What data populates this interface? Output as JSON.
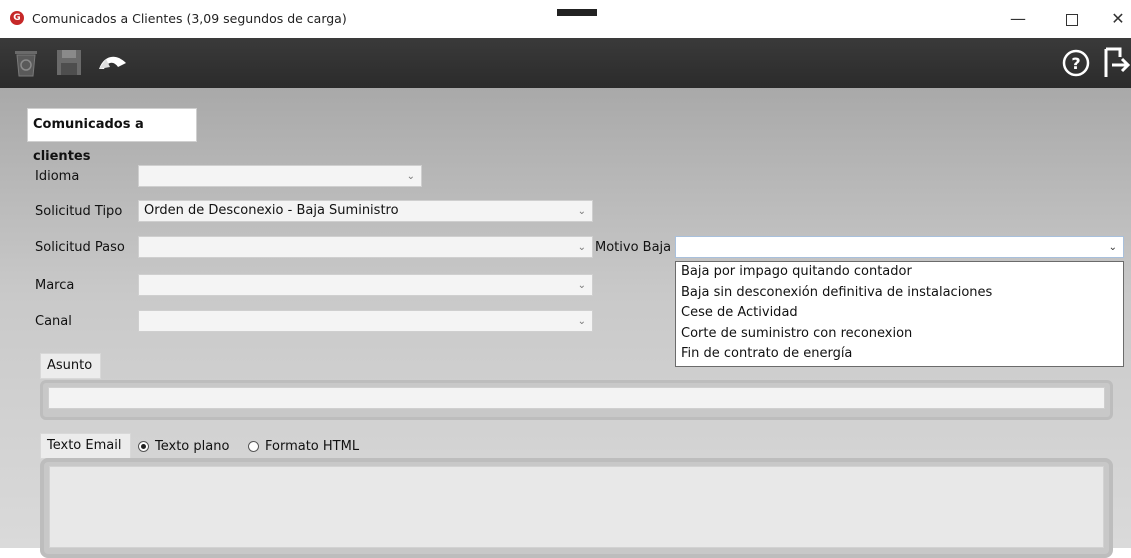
{
  "window": {
    "title": "Comunicados a Clientes (3,09 segundos de carga)",
    "minimize": "—",
    "close": "✕"
  },
  "toolbar": {
    "icons": [
      "trash-icon",
      "save-icon",
      "undo-icon",
      "help-icon",
      "exit-icon"
    ]
  },
  "form": {
    "section_title": "Comunicados a clientes",
    "idioma": {
      "label": "Idioma",
      "value": ""
    },
    "solicitud_tipo": {
      "label": "Solicitud Tipo",
      "value": "Orden de Desconexio - Baja Suministro"
    },
    "solicitud_paso": {
      "label": "Solicitud Paso",
      "value": ""
    },
    "motivo_baja": {
      "label": "Motivo Baja",
      "value": "",
      "options": [
        "Baja por impago quitando contador",
        "Baja sin desconexión definitiva de instalaciones",
        "Cese de Actividad",
        "Corte de suministro con reconexion",
        "Fin de contrato de energía"
      ]
    },
    "marca": {
      "label": "Marca",
      "value": ""
    },
    "canal": {
      "label": "Canal",
      "value": ""
    },
    "asunto": {
      "label": "Asunto",
      "value": ""
    },
    "texto_email": {
      "label": "Texto Email",
      "radio_plain": "Texto plano",
      "radio_html": "Formato HTML",
      "selected": "Texto plano"
    }
  }
}
